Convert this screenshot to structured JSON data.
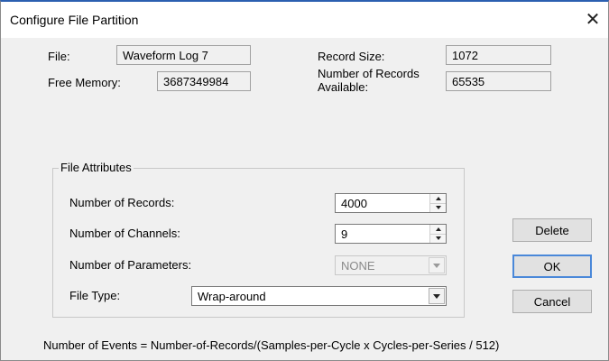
{
  "window": {
    "title": "Configure File Partition",
    "close_glyph": "✕"
  },
  "info": {
    "file_label": "File:",
    "file_value": "Waveform Log 7",
    "free_memory_label": "Free Memory:",
    "free_memory_value": "3687349984",
    "record_size_label": "Record Size:",
    "record_size_value": "1072",
    "records_available_label_line1": "Number of Records",
    "records_available_label_line2": "Available:",
    "records_available_value": "65535"
  },
  "attributes": {
    "legend": "File Attributes",
    "num_records_label": "Number of Records:",
    "num_records_value": "4000",
    "num_channels_label": "Number of Channels:",
    "num_channels_value": "9",
    "num_parameters_label": "Number of Parameters:",
    "num_parameters_value": "NONE",
    "file_type_label": "File Type:",
    "file_type_value": "Wrap-around"
  },
  "buttons": {
    "delete": "Delete",
    "ok": "OK",
    "cancel": "Cancel"
  },
  "footer": {
    "formula": "Number of Events = Number-of-Records/(Samples-per-Cycle x Cycles-per-Series / 512)"
  },
  "icons": {
    "close": "close-icon",
    "spin_up": "spin-up-icon",
    "spin_down": "spin-down-icon",
    "dropdown": "chevron-down-icon"
  },
  "colors": {
    "title_bar_accent": "#2b5fb0",
    "default_button_border": "#4a88d9",
    "dialog_bg": "#f0f0f0"
  }
}
